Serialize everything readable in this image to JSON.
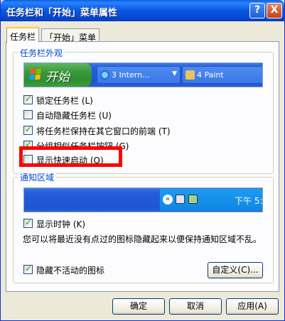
{
  "window": {
    "title": "任务栏和「开始」菜单属性",
    "help_label": "?",
    "close_label": "X"
  },
  "tabs": [
    {
      "label": "任务栏",
      "active": true
    },
    {
      "label": "「开始」菜单",
      "active": false
    }
  ],
  "taskbar_group": {
    "title": "任务栏外观",
    "preview": {
      "start_label": "开始",
      "task_buttons": [
        "3 Intern...",
        "4 Paint"
      ]
    },
    "options": [
      {
        "label": "锁定任务栏 (L)",
        "checked": true
      },
      {
        "label": "自动隐藏任务栏 (U)",
        "checked": false
      },
      {
        "label": "将任务栏保持在其它窗口的前端 (T)",
        "checked": true
      },
      {
        "label": "分组相似任务栏按钮 (G)",
        "checked": true
      },
      {
        "label": "显示快速启动 (Q)",
        "checked": false
      }
    ]
  },
  "tray_group": {
    "title": "通知区域",
    "preview_time": "下午 5:53",
    "show_clock": {
      "label": "显示时钟 (K)",
      "checked": true
    },
    "description": "您可以将最近没有点过的图标隐藏起来以便保持通知区域不乱。",
    "hide_inactive": {
      "label": "隐藏不活动的图标",
      "checked": true
    },
    "customize_label": "自定义(C)..."
  },
  "buttons": {
    "ok": "确定",
    "cancel": "取消",
    "apply": "应用(A)"
  },
  "colors": {
    "highlight_box": "#ff0000",
    "group_title": "#0046d5",
    "title_bar": "#0548d5"
  }
}
